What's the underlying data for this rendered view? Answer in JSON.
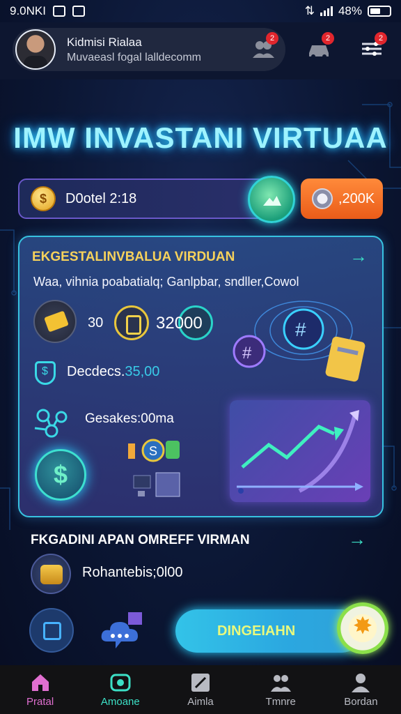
{
  "status": {
    "time": "9.0NKI",
    "battery": "48%"
  },
  "header": {
    "name": "Kidmisi Rialaa",
    "email": "Muvaeasl fogal lalldecomm",
    "badge1": "2",
    "badge2": "2",
    "badge3": "2"
  },
  "title": "IMW INVASTANI VIRTUAA",
  "balance": {
    "value": "D0otel 2:18",
    "coin_symbol": "$",
    "chip_label": ",200K"
  },
  "card": {
    "title": "EKGESTALINVBALUA VIRDUAN",
    "subtitle": "Waa, vihnia poabatialq; Ganlpbar, sndller,Cowol",
    "value_30": "30",
    "value_32000": "32000",
    "decedes_label": "Decdecs.",
    "decedes_value": "35,00",
    "gesakes": "Gesakes:00ma",
    "dollar_symbol": "$"
  },
  "section2": {
    "title": "FKGADINI APAN OMREFF VIRMAN",
    "item": "Rohantebis;0l00"
  },
  "cta": {
    "label": "DINGEIAHN"
  },
  "nav": [
    {
      "label": "Pratal",
      "icon": "home-icon"
    },
    {
      "label": "Amoane",
      "icon": "camera-icon"
    },
    {
      "label": "Aimla",
      "icon": "edit-icon"
    },
    {
      "label": "Tmnre",
      "icon": "group-icon"
    },
    {
      "label": "Bordan",
      "icon": "person-icon"
    }
  ],
  "colors": {
    "accent": "#3ce0c6",
    "title_glow": "#2fd3ff",
    "gold": "#f7d25b",
    "orange": "#ea5c19",
    "nav_active": "#e06fd0"
  }
}
